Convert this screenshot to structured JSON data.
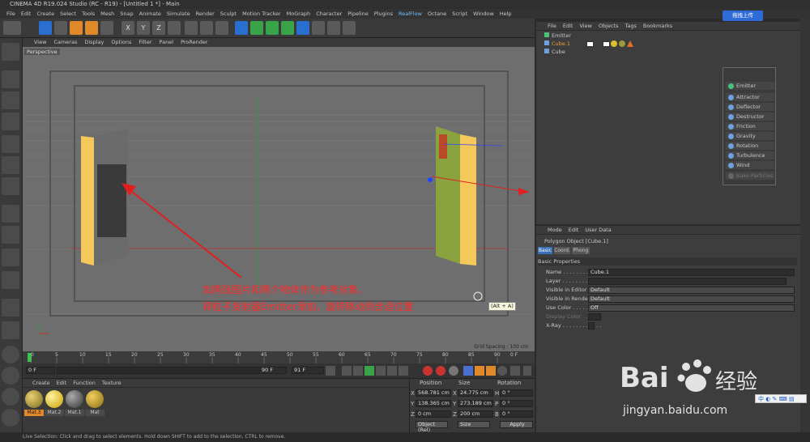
{
  "titlebar": {
    "title": "CINEMA 4D R19.024 Studio (RC - R19) - [Untitled 1 *] - Main"
  },
  "menubar": {
    "items": [
      "File",
      "Edit",
      "Create",
      "Select",
      "Tools",
      "Mesh",
      "Snap",
      "Animate",
      "Simulate",
      "Render",
      "Sculpt",
      "Motion Tracker",
      "MoGraph",
      "Character",
      "Pipeline",
      "Plugins",
      "RealFlow",
      "Octane",
      "Script",
      "Window",
      "Help"
    ]
  },
  "cloud_button": "拖拽上传",
  "toolbar": {
    "axis_labels": [
      "X",
      "Y",
      "Z"
    ]
  },
  "viewport_menu": {
    "items": [
      "View",
      "Cameras",
      "Display",
      "Options",
      "Filter",
      "Panel",
      "ProRender"
    ]
  },
  "viewport": {
    "label": "Perspective",
    "grid_spacing": "Grid Spacing : 100 cm"
  },
  "annotation": {
    "line1": "加两张图片和两个物体作为参考对象，",
    "line2": "将粒子发射器Emitter添加，旋转移动到合适位置"
  },
  "tooltip": "(Alt + A)",
  "timeline": {
    "ticks": [
      "0",
      "5",
      "10",
      "15",
      "20",
      "25",
      "30",
      "35",
      "40",
      "45",
      "50",
      "55",
      "60",
      "65",
      "70",
      "75",
      "80",
      "85",
      "90"
    ],
    "end_marker": "0 F"
  },
  "playbar": {
    "current_frame": "0 F",
    "start_field": "0 F",
    "end_field": "90 F",
    "max_field": "91 F"
  },
  "material_panel": {
    "menu": [
      "Create",
      "Edit",
      "Function",
      "Texture"
    ],
    "materials": [
      "Mat.3",
      "Mat.2",
      "Mat.1",
      "Mat"
    ]
  },
  "coord_panel": {
    "headers": [
      "Position",
      "Size",
      "Rotation"
    ],
    "rows": [
      {
        "axis": "X",
        "pos": "568.781 cm",
        "size_axis": "X",
        "size": "24.775 cm",
        "rot_axis": "H",
        "rot": "0 °"
      },
      {
        "axis": "Y",
        "pos": "138.365 cm",
        "size_axis": "Y",
        "size": "273.189 cm",
        "rot_axis": "P",
        "rot": "0 °"
      },
      {
        "axis": "Z",
        "pos": "0 cm",
        "size_axis": "Z",
        "size": "200 cm",
        "rot_axis": "B",
        "rot": "0 °"
      }
    ],
    "mode_select": "Object (Rel)",
    "size_select": "Size",
    "apply_label": "Apply"
  },
  "object_manager": {
    "menu": [
      "File",
      "Edit",
      "View",
      "Objects",
      "Tags",
      "Bookmarks"
    ],
    "objects": [
      {
        "name": "Emitter",
        "color": "#cfcfcf"
      },
      {
        "name": "Cube.1",
        "color": "#e8a23a"
      },
      {
        "name": "Cube",
        "color": "#cfcfcf"
      }
    ]
  },
  "popup_menu": {
    "items": [
      "Emitter",
      "Attractor",
      "Deflector",
      "Destructor",
      "Friction",
      "Gravity",
      "Rotation",
      "Turbulence",
      "Wind",
      "Bake Particles"
    ]
  },
  "attribute_manager": {
    "menu": [
      "Mode",
      "Edit",
      "User Data"
    ],
    "object_title": "Polygon Object [Cube.1]",
    "tabs": [
      "Basic",
      "Coord.",
      "Phong"
    ],
    "section": "Basic Properties",
    "fields": [
      {
        "label": "Name . . . . . . . . . . . . .",
        "value": "Cube.1"
      },
      {
        "label": "Layer . . . . . . . . . . . . .",
        "value": ""
      },
      {
        "label": "Visible in Editor . . .",
        "value": "Default"
      },
      {
        "label": "Visible in Renderer",
        "value": "Default"
      },
      {
        "label": "Use Color . . . . . . . .",
        "value": "Off"
      },
      {
        "label": "Display Color . . . . .",
        "value": ""
      },
      {
        "label": "X-Ray . . . . . . . . . . . .",
        "value": ""
      }
    ]
  },
  "statusbar": "Live Selection: Click and drag to select elements. Hold down SHIFT to add to the selection, CTRL to remove.",
  "ime_bar": "中 ◐ ✎ ⌨ ▤",
  "watermark": {
    "brand": "Bai",
    "brand_cn": "经验",
    "url": "jingyan.baidu.com"
  },
  "colors": {
    "accent": "#2a6fd0",
    "annotation": "#ff2a2a",
    "timeline_current": "#39c24a"
  }
}
